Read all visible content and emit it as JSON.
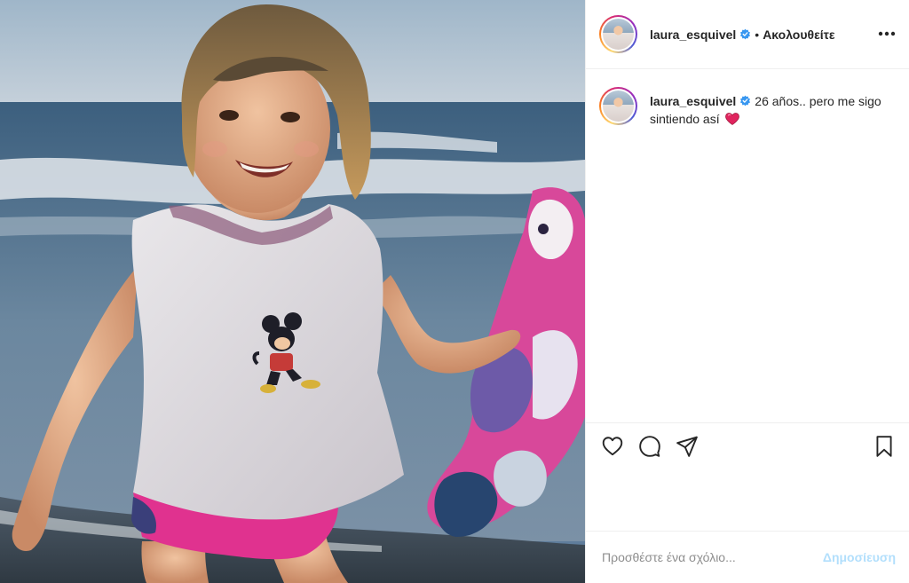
{
  "post": {
    "author": {
      "username": "laura_esquivel",
      "verified": true,
      "follow_separator": "•",
      "follow_state": "Ακολουθείτε"
    },
    "more_icon": "more-horizontal-icon",
    "caption": {
      "username": "laura_esquivel",
      "text": "26 años.. pero me sigo sintiendo así",
      "emoji": "red-heart-emoji"
    },
    "actions": [
      {
        "name": "like",
        "icon": "heart-icon"
      },
      {
        "name": "comment",
        "icon": "comment-icon"
      },
      {
        "name": "share",
        "icon": "paper-plane-icon"
      },
      {
        "name": "save",
        "icon": "bookmark-icon"
      }
    ],
    "comment_box": {
      "placeholder": "Προσθέστε ένα σχόλιο...",
      "submit_label": "Δημοσίευση"
    }
  },
  "colors": {
    "verified_blue": "#3897f0",
    "submit_disabled": "#b2dffc",
    "heart_red": "#e0245e",
    "divider": "#efefef"
  }
}
